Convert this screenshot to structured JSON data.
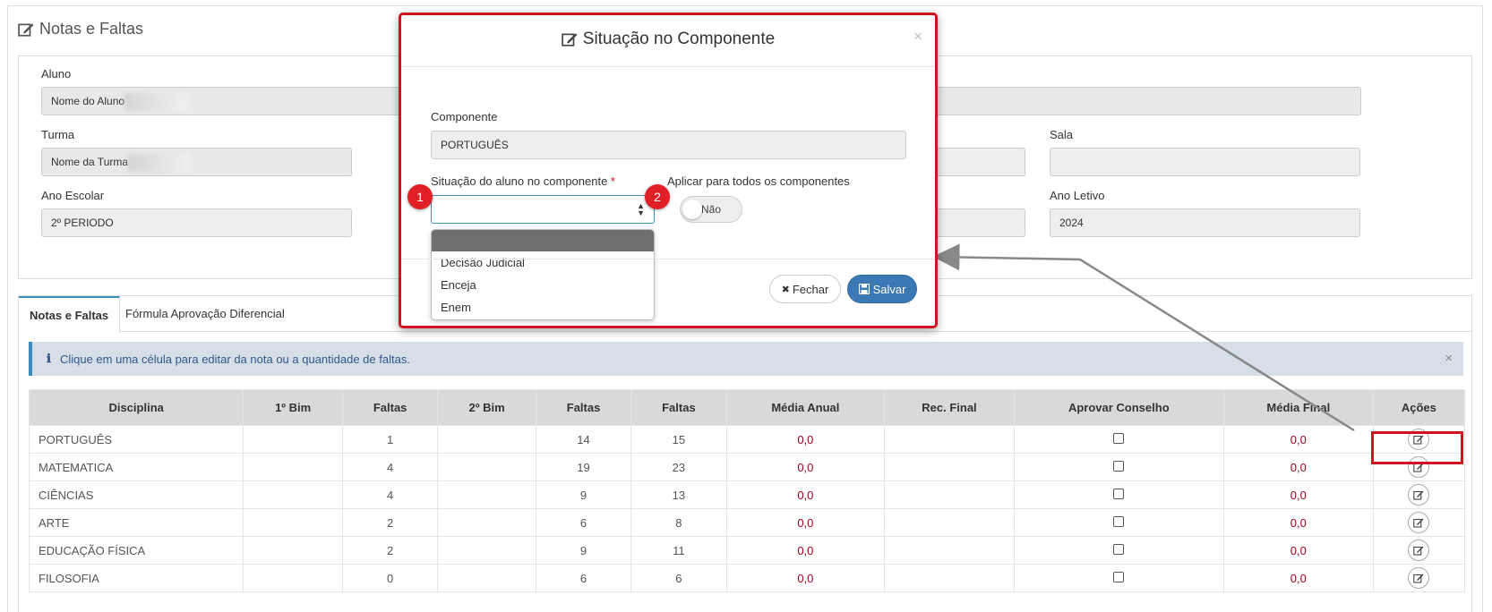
{
  "page": {
    "title": "Notas e Faltas"
  },
  "form": {
    "aluno_label": "Aluno",
    "aluno_value": "Nome do Aluno",
    "turma_label": "Turma",
    "turma_value": "Nome da Turma",
    "sala_label": "Sala",
    "sala_value": "",
    "ano_escolar_label": "Ano Escolar",
    "ano_escolar_value": "2º PERIODO",
    "ano_letivo_label": "Ano Letivo",
    "ano_letivo_value": "2024"
  },
  "tabs": [
    {
      "label": "Notas e Faltas"
    },
    {
      "label": "Fórmula Aprovação Diferencial"
    }
  ],
  "alert": {
    "icon": "ℹ",
    "text": "Clique em uma célula para editar da nota ou a quantidade de faltas.",
    "close": "×"
  },
  "table": {
    "headers": [
      "Disciplina",
      "1º Bim",
      "Faltas",
      "2º Bim",
      "Faltas",
      "Faltas",
      "Média Anual",
      "Rec. Final",
      "Aprovar Conselho",
      "Média Final",
      "Ações"
    ],
    "rows": [
      {
        "disciplina": "PORTUGUÊS",
        "bim1": "",
        "faltas1": "1",
        "bim2": "",
        "faltas2": "14",
        "faltas3": "15",
        "media_anual": "0,0",
        "rec_final": "",
        "media_final": "0,0"
      },
      {
        "disciplina": "MATEMATICA",
        "bim1": "",
        "faltas1": "4",
        "bim2": "",
        "faltas2": "19",
        "faltas3": "23",
        "media_anual": "0,0",
        "rec_final": "",
        "media_final": "0,0"
      },
      {
        "disciplina": "CIÊNCIAS",
        "bim1": "",
        "faltas1": "4",
        "bim2": "",
        "faltas2": "9",
        "faltas3": "13",
        "media_anual": "0,0",
        "rec_final": "",
        "media_final": "0,0"
      },
      {
        "disciplina": "ARTE",
        "bim1": "",
        "faltas1": "2",
        "bim2": "",
        "faltas2": "6",
        "faltas3": "8",
        "media_anual": "0,0",
        "rec_final": "",
        "media_final": "0,0"
      },
      {
        "disciplina": "EDUCAÇÃO FÍSICA",
        "bim1": "",
        "faltas1": "2",
        "bim2": "",
        "faltas2": "9",
        "faltas3": "11",
        "media_anual": "0,0",
        "rec_final": "",
        "media_final": "0,0"
      },
      {
        "disciplina": "FILOSOFIA",
        "bim1": "",
        "faltas1": "0",
        "bim2": "",
        "faltas2": "6",
        "faltas3": "6",
        "media_anual": "0,0",
        "rec_final": "",
        "media_final": "0,0"
      }
    ]
  },
  "modal": {
    "title": "Situação no Componente",
    "close": "×",
    "componente_label": "Componente",
    "componente_value": "PORTUGUÊS",
    "situacao_label": "Situação do aluno no componente",
    "required_mark": "*",
    "situacao_value": "",
    "situacao_options": [
      "",
      "Decisão Judicial",
      "Enceja",
      "Enem"
    ],
    "aplicar_label": "Aplicar para todos os componentes",
    "toggle_value": "Não",
    "fechar_label": "Fechar",
    "fechar_icon": "✖",
    "salvar_label": "Salvar"
  },
  "annotations": {
    "badge1": "1",
    "badge2": "2"
  },
  "colors": {
    "highlight": "#d0131e",
    "primary": "#3c78b4",
    "value_red": "#a5001e"
  }
}
